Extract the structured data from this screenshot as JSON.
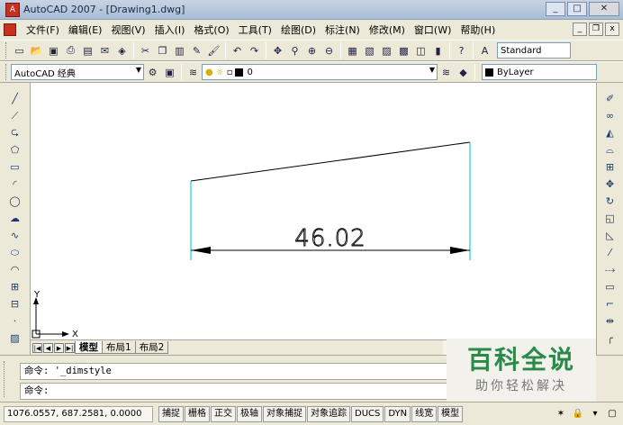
{
  "window": {
    "title": "AutoCAD 2007 - [Drawing1.dwg]",
    "logo": "A",
    "minimize": "_",
    "maximize": "□",
    "close": "✕"
  },
  "menu": {
    "items": [
      "文件(F)",
      "编辑(E)",
      "视图(V)",
      "插入(I)",
      "格式(O)",
      "工具(T)",
      "绘图(D)",
      "标注(N)",
      "修改(M)",
      "窗口(W)",
      "帮助(H)"
    ],
    "doc_minimize": "_",
    "doc_restore": "❐",
    "doc_close": "x"
  },
  "toolbar1": {
    "icons": [
      "new-icon",
      "open-icon",
      "save-icon",
      "print-icon",
      "preview-icon",
      "publish-icon",
      "plot-icon",
      "cut-icon",
      "copy-icon",
      "paste-icon",
      "matchprop-icon",
      "brush-icon",
      "undo-icon",
      "redo-icon",
      "pan-icon",
      "zoom-realtime-icon",
      "zoom-window-icon",
      "zoom-previous-icon",
      "properties-icon",
      "designcenter-icon",
      "toolpalettes-icon",
      "sheetset-icon",
      "markup-icon",
      "calculator-icon",
      "help-icon"
    ],
    "text_style_icon": "text-style-icon",
    "text_style": "Standard"
  },
  "toolbar2": {
    "workspace": "AutoCAD 经典",
    "layer": "0",
    "color": "ByLayer"
  },
  "left_palette": [
    "line-icon",
    "construction-line-icon",
    "polyline-icon",
    "polygon-icon",
    "rectangle-icon",
    "arc-icon",
    "circle-icon",
    "revcloud-icon",
    "spline-icon",
    "ellipse-icon",
    "ellipse-arc-icon",
    "insert-block-icon",
    "make-block-icon",
    "point-icon",
    "hatch-icon"
  ],
  "right_palette": [
    "erase-icon",
    "copy-object-icon",
    "mirror-icon",
    "offset-icon",
    "array-icon",
    "move-icon",
    "rotate-icon",
    "scale-icon",
    "stretch-icon",
    "trim-icon",
    "extend-icon",
    "break-icon",
    "chamfer-icon",
    "join-icon",
    "fillet-icon"
  ],
  "drawing": {
    "dimension_text": "46.02",
    "ucs_x": "X",
    "ucs_y": "Y"
  },
  "tabs": {
    "items": [
      "模型",
      "布局1",
      "布局2"
    ],
    "active": 0
  },
  "command": {
    "history": "命令: '_dimstyle",
    "prompt": "命令:"
  },
  "watermark": {
    "title": "百科全说",
    "subtitle": "助你轻松解决"
  },
  "status": {
    "coords": "1076.0557, 687.2581, 0.0000",
    "toggles": [
      "捕捉",
      "栅格",
      "正交",
      "极轴",
      "对象捕捉",
      "对象追踪",
      "DUCS",
      "DYN",
      "线宽",
      "模型"
    ]
  }
}
